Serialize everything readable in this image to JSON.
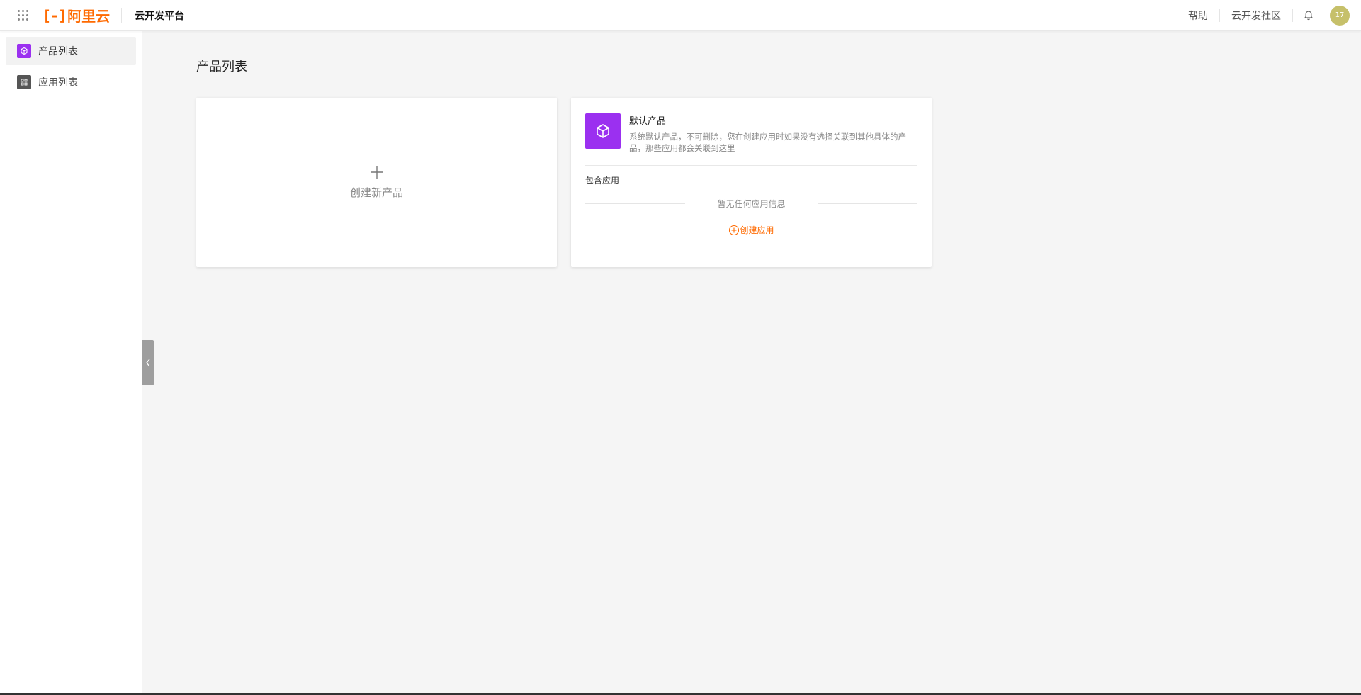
{
  "header": {
    "logo_text": "阿里云",
    "platform_title": "云开发平台",
    "links": [
      "帮助",
      "云开发社区"
    ],
    "avatar_text": "17"
  },
  "sidebar": {
    "items": [
      {
        "label": "产品列表",
        "icon": "cube-icon",
        "color": "#9b30f0",
        "active": true
      },
      {
        "label": "应用列表",
        "icon": "apps-icon",
        "color": "#555555",
        "active": false
      }
    ]
  },
  "main": {
    "page_title": "产品列表",
    "create_card": {
      "label": "创建新产品"
    },
    "product_card": {
      "name": "默认产品",
      "description": "系统默认产品，不可删除，您在创建应用时如果没有选择关联到其他具体的产品，那些应用都会关联到这里",
      "contains_label": "包含应用",
      "empty_text": "暂无任何应用信息",
      "create_app_label": "创建应用"
    }
  },
  "colors": {
    "brand": "#ff6a00",
    "product_icon": "#9b30f0"
  }
}
